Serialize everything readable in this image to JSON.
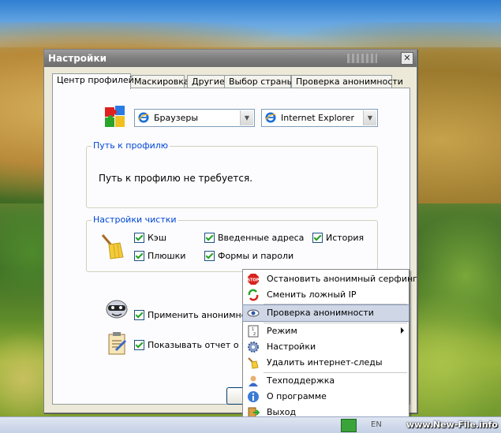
{
  "window": {
    "title": "Настройки",
    "close_symbol": "✕"
  },
  "tabs": [
    {
      "label": "Центр профилей",
      "active": true
    },
    {
      "label": "Маскировка",
      "active": false
    },
    {
      "label": "Другие",
      "active": false
    },
    {
      "label": "Выбор страны",
      "active": false
    },
    {
      "label": "Проверка анонимности",
      "active": false
    }
  ],
  "profile": {
    "category_select": {
      "value": "Браузеры",
      "icon": "ie-icon"
    },
    "browser_select": {
      "value": "Internet Explorer",
      "icon": "ie-icon"
    }
  },
  "profile_path": {
    "group_label": "Путь к профилю",
    "message": "Путь к профилю не требуется."
  },
  "cleanup": {
    "group_label": "Настройки чистки",
    "items": [
      {
        "label": "Кэш",
        "checked": true
      },
      {
        "label": "Введенные адреса",
        "checked": true
      },
      {
        "label": "История",
        "checked": true
      },
      {
        "label": "Плюшки",
        "checked": true
      },
      {
        "label": "Формы и пароли",
        "checked": true
      }
    ]
  },
  "options": {
    "apply_anonymity": {
      "label": "Применить анонимность",
      "checked": true
    },
    "show_report": {
      "label": "Показывать отчет о чис",
      "checked": true
    }
  },
  "context_menu": {
    "items": [
      {
        "label": "Остановить анонимный серфинг",
        "icon": "stop-icon"
      },
      {
        "label": "Сменить ложный IP",
        "icon": "refresh-icon"
      },
      {
        "label": "Проверка анонимности",
        "icon": "eye-icon",
        "highlighted": true
      },
      {
        "label": "Режим",
        "icon": "mode-icon",
        "submenu": true
      },
      {
        "label": "Настройки",
        "icon": "gear-icon"
      },
      {
        "label": "Удалить интернет-следы",
        "icon": "broom-icon"
      },
      {
        "label": "Техподдержка",
        "icon": "support-icon"
      },
      {
        "label": "О программе",
        "icon": "info-icon"
      },
      {
        "label": "Выход",
        "icon": "exit-icon"
      }
    ]
  },
  "taskbar": {
    "lang": "EN",
    "watermark": "www.New-File.info"
  },
  "colors": {
    "group_label": "#0046d5",
    "menu_highlight": "#cfd7e6",
    "titlebar": "#7d7d7d"
  }
}
